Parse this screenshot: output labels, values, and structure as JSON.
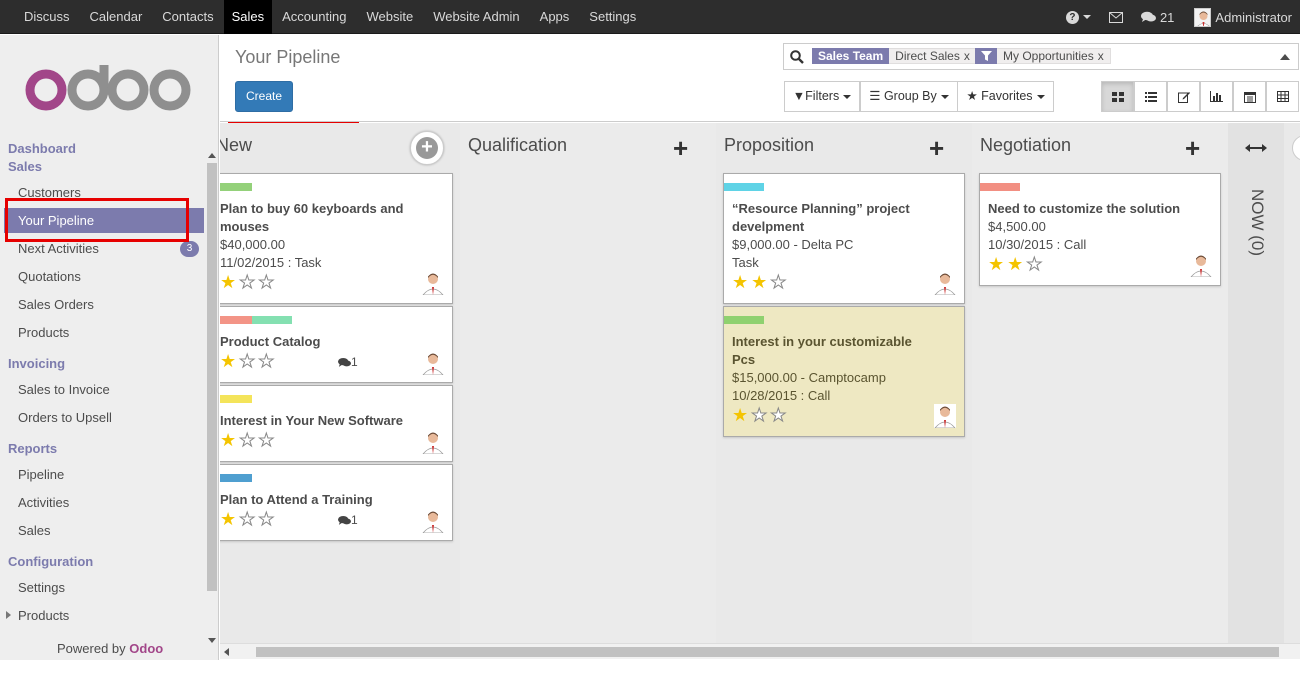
{
  "topmenu": [
    "Discuss",
    "Calendar",
    "Contacts",
    "Sales",
    "Accounting",
    "Website",
    "Website Admin",
    "Apps",
    "Settings"
  ],
  "topmenu_active": "Sales",
  "topright": {
    "messages_count": "21",
    "user": "Administrator"
  },
  "sidebar": {
    "logo_text": "odoo",
    "sections": [
      {
        "title": "Dashboard"
      },
      {
        "title": "Sales",
        "items": [
          {
            "label": "Customers"
          },
          {
            "label": "Your Pipeline",
            "active": true
          },
          {
            "label": "Next Activities",
            "badge": "3"
          },
          {
            "label": "Quotations"
          },
          {
            "label": "Sales Orders"
          },
          {
            "label": "Products"
          }
        ]
      },
      {
        "title": "Invoicing",
        "items": [
          {
            "label": "Sales to Invoice"
          },
          {
            "label": "Orders to Upsell"
          }
        ]
      },
      {
        "title": "Reports",
        "items": [
          {
            "label": "Pipeline"
          },
          {
            "label": "Activities"
          },
          {
            "label": "Sales"
          }
        ]
      },
      {
        "title": "Configuration",
        "items": [
          {
            "label": "Settings"
          },
          {
            "label": "Products",
            "expandable": true
          }
        ]
      }
    ],
    "powered_by": "Powered by",
    "powered_brand": "Odoo"
  },
  "control_panel": {
    "title": "Your Pipeline",
    "create_label": "Create",
    "search": {
      "facets": [
        {
          "label": "Sales Team",
          "value": "Direct Sales"
        },
        {
          "label": "filter-icon",
          "value": "My Opportunities"
        }
      ]
    },
    "filters_label": "Filters",
    "groupby_label": "Group By",
    "favorites_label": "Favorites",
    "views": [
      "kanban-icon",
      "list-icon",
      "form-icon",
      "graph-icon",
      "calendar-icon",
      "pivot-icon"
    ],
    "active_view": "kanban-icon"
  },
  "kanban": {
    "columns": [
      {
        "title": "New",
        "cards": [
          {
            "title_lines": [
              "Plan to buy 60 keyboards and",
              "mouses"
            ],
            "lines": [
              "$40,000.00",
              "11/02/2015 : Task"
            ],
            "tags": [
              "#94d17a"
            ],
            "stars": 1
          },
          {
            "title_lines": [
              "Product Catalog"
            ],
            "lines": [],
            "tags": [
              "#f39486",
              "#84e0b1"
            ],
            "stars": 1,
            "comments": "1"
          },
          {
            "title_lines": [
              "Interest in Your New Software"
            ],
            "lines": [],
            "tags": [
              "#f4e45a"
            ],
            "stars": 1
          },
          {
            "title_lines": [
              "Plan to Attend a Training"
            ],
            "lines": [],
            "tags": [
              "#4f9fd0"
            ],
            "stars": 1,
            "comments": "1"
          }
        ]
      },
      {
        "title": "Qualification",
        "cards": []
      },
      {
        "title": "Proposition",
        "cards": [
          {
            "title_lines": [
              "“Resource Planning” project",
              "develpment"
            ],
            "lines": [
              "$9,000.00 - Delta PC",
              "Task"
            ],
            "tags": [
              "#5fd3e6"
            ],
            "stars": 2
          },
          {
            "title_lines": [
              "Interest in your customizable",
              "Pcs"
            ],
            "lines": [
              "$15,000.00 - Camptocamp",
              "10/28/2015 : Call"
            ],
            "tags": [
              "#8fd16f"
            ],
            "stars": 1,
            "highlight": true
          }
        ]
      },
      {
        "title": "Negotiation",
        "cards": [
          {
            "title_lines": [
              "Need to customize the solution"
            ],
            "lines": [
              "$4,500.00",
              "10/30/2015 : Call"
            ],
            "tags": [
              "#f28f82"
            ],
            "stars": 2
          }
        ]
      }
    ],
    "folded_column": "NOW (0)"
  }
}
